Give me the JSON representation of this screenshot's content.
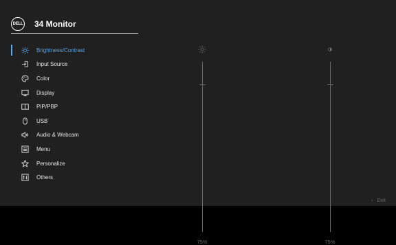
{
  "header": {
    "logo_text": "DELL",
    "title": "34 Monitor"
  },
  "menu": {
    "items": [
      {
        "label": "Brightness/Contrast",
        "icon": "brightness-icon",
        "active": true
      },
      {
        "label": "Input Source",
        "icon": "input-source-icon"
      },
      {
        "label": "Color",
        "icon": "color-palette-icon"
      },
      {
        "label": "Display",
        "icon": "display-icon"
      },
      {
        "label": "PIP/PBP",
        "icon": "pip-pbp-icon"
      },
      {
        "label": "USB",
        "icon": "usb-mouse-icon"
      },
      {
        "label": "Audio & Webcam",
        "icon": "speaker-icon"
      },
      {
        "label": "Menu",
        "icon": "menu-list-icon"
      },
      {
        "label": "Personalize",
        "icon": "star-icon"
      },
      {
        "label": "Others",
        "icon": "others-icon"
      }
    ]
  },
  "sliders": {
    "brightness": {
      "value": "75%",
      "icon": "brightness-icon",
      "level": 0.75
    },
    "contrast": {
      "value": "75%",
      "icon": "contrast-icon",
      "level": 0.75
    }
  },
  "footer": {
    "exit_label": "Exit",
    "exit_icon": "chevron-left-icon"
  },
  "colors": {
    "accent": "#5fa6e5",
    "background": "#202020",
    "text": "#e6e6e6",
    "muted": "#6b6b6b"
  }
}
